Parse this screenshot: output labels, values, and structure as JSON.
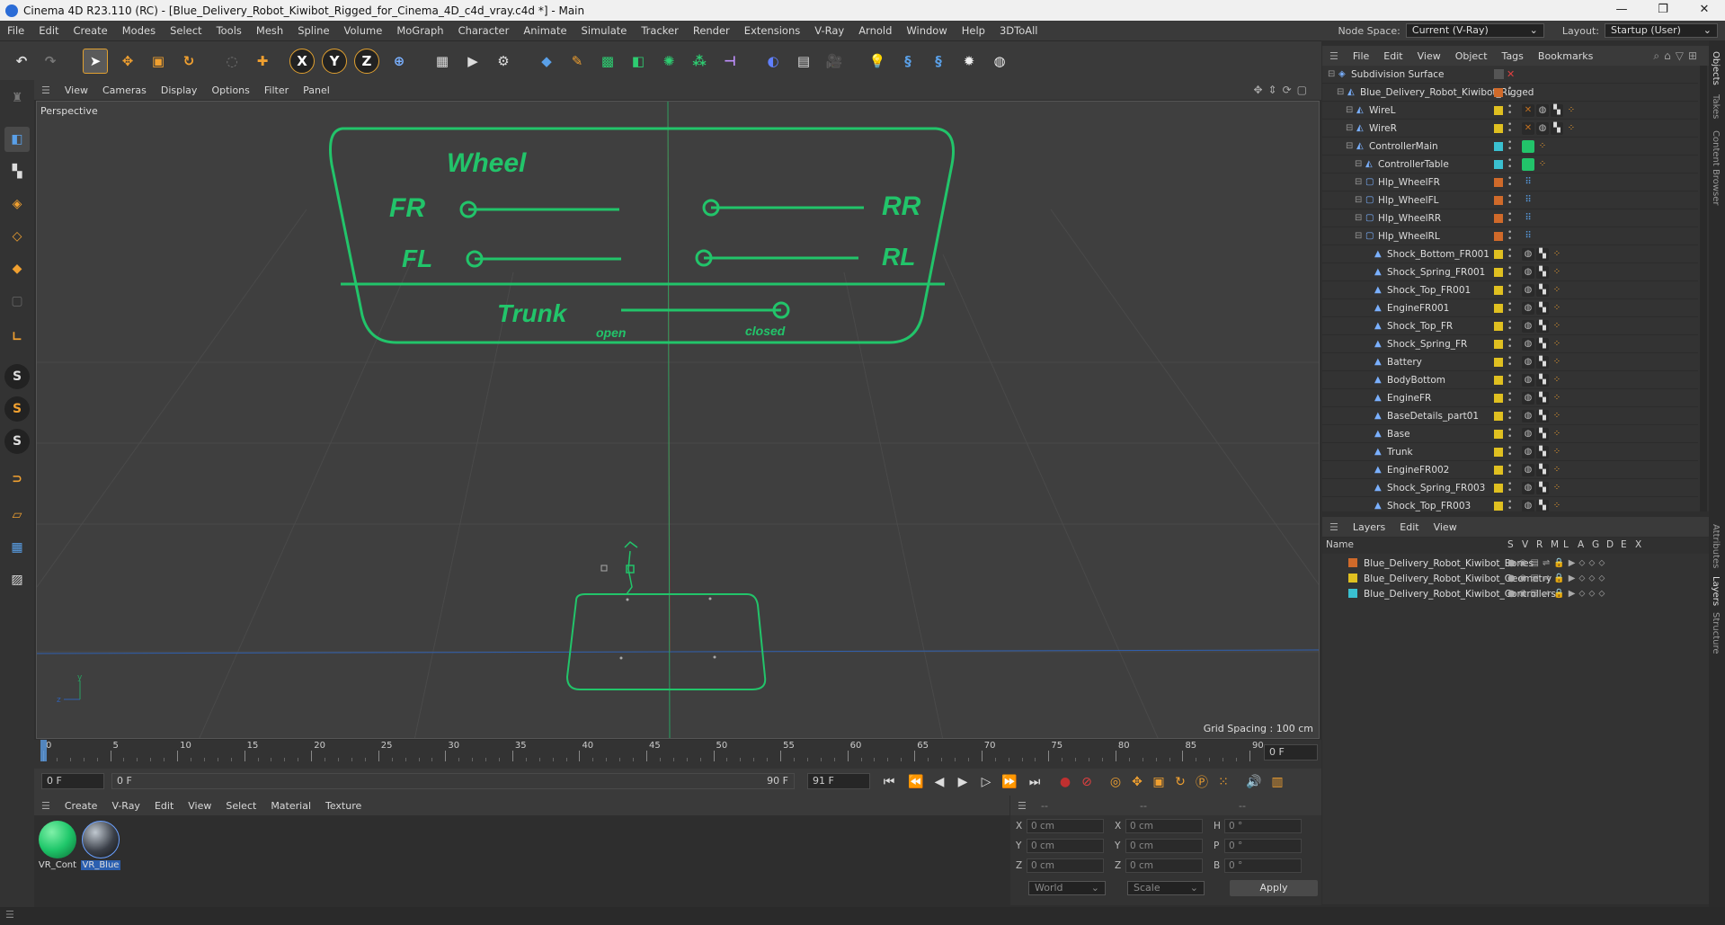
{
  "window": {
    "title": "Cinema 4D R23.110 (RC) - [Blue_Delivery_Robot_Kiwibot_Rigged_for_Cinema_4D_c4d_vray.c4d *] - Main",
    "controls": [
      "—",
      "❐",
      "✕"
    ]
  },
  "menubar": {
    "items": [
      "File",
      "Edit",
      "Create",
      "Modes",
      "Select",
      "Tools",
      "Mesh",
      "Spline",
      "Volume",
      "MoGraph",
      "Character",
      "Animate",
      "Simulate",
      "Tracker",
      "Render",
      "Extensions",
      "V-Ray",
      "Arnold",
      "Window",
      "Help",
      "3DToAll"
    ],
    "node_space_label": "Node Space:",
    "node_space_value": "Current (V-Ray)",
    "layout_label": "Layout:",
    "layout_value": "Startup (User)"
  },
  "viewport": {
    "menu": [
      "View",
      "Cameras",
      "Display",
      "Options",
      "Filter",
      "Panel"
    ],
    "camera_label": "Perspective",
    "grid_spacing": "Grid Spacing : 100 cm",
    "controller": {
      "title": "Wheel",
      "fr": "FR",
      "rr": "RR",
      "fl": "FL",
      "rl": "RL",
      "trunk": "Trunk",
      "open": "open",
      "closed": "closed"
    },
    "colors": {
      "controller": "#22c46a",
      "axis_red": "#b03030",
      "axis_blue": "#3060b0"
    }
  },
  "timeline": {
    "ticks": [
      "0",
      "5",
      "10",
      "15",
      "20",
      "25",
      "30",
      "35",
      "40",
      "45",
      "50",
      "55",
      "60",
      "65",
      "70",
      "75",
      "80",
      "85",
      "90"
    ],
    "current_frame_display": "0 F",
    "start_field": "0 F",
    "range_start": "0 F",
    "range_end": "90 F",
    "end_field": "91 F"
  },
  "materials": {
    "menu": [
      "Create",
      "V-Ray",
      "Edit",
      "View",
      "Select",
      "Material",
      "Texture"
    ],
    "items": [
      {
        "name": "VR_Cont",
        "color": "#1fc76a"
      },
      {
        "name": "VR_Blue",
        "color": "#3a3f48"
      }
    ]
  },
  "coordinates": {
    "header": [
      "--",
      "--",
      "--"
    ],
    "rows": [
      {
        "a": "X",
        "av": "0 cm",
        "b": "X",
        "bv": "0 cm",
        "c": "H",
        "cv": "0 °"
      },
      {
        "a": "Y",
        "av": "0 cm",
        "b": "Y",
        "bv": "0 cm",
        "c": "P",
        "cv": "0 °"
      },
      {
        "a": "Z",
        "av": "0 cm",
        "b": "Z",
        "bv": "0 cm",
        "c": "B",
        "cv": "0 °"
      }
    ],
    "world": "World",
    "scale": "Scale",
    "apply": "Apply"
  },
  "object_manager": {
    "menu": [
      "File",
      "Edit",
      "View",
      "Object",
      "Tags",
      "Bookmarks"
    ],
    "objects": [
      {
        "name": "Subdivision Surface",
        "indent": 0,
        "chip": "",
        "tags": []
      },
      {
        "name": "Blue_Delivery_Robot_Kiwibot_Rigged",
        "indent": 1,
        "chip": "#d06a2a",
        "tags": []
      },
      {
        "name": "WireL",
        "indent": 2,
        "chip": "#e0c020",
        "tags": [
          "x",
          "s",
          "c",
          "d"
        ]
      },
      {
        "name": "WireR",
        "indent": 2,
        "chip": "#e0c020",
        "tags": [
          "x",
          "s",
          "c",
          "d"
        ]
      },
      {
        "name": "ControllerMain",
        "indent": 2,
        "chip": "#3ac0d0",
        "tags": [
          "g",
          "d"
        ]
      },
      {
        "name": "ControllerTable",
        "indent": 3,
        "chip": "#3ac0d0",
        "tags": [
          "g",
          "d"
        ]
      },
      {
        "name": "Hlp_WheelFR",
        "indent": 3,
        "chip": "#d06a2a",
        "tags": [
          "p"
        ]
      },
      {
        "name": "Hlp_WheelFL",
        "indent": 3,
        "chip": "#d06a2a",
        "tags": [
          "p"
        ]
      },
      {
        "name": "Hlp_WheelRR",
        "indent": 3,
        "chip": "#d06a2a",
        "tags": [
          "p"
        ]
      },
      {
        "name": "Hlp_WheelRL",
        "indent": 3,
        "chip": "#d06a2a",
        "tags": [
          "p"
        ]
      },
      {
        "name": "Shock_Bottom_FR001",
        "indent": 4,
        "chip": "#e0c020",
        "tags": [
          "s",
          "c",
          "d"
        ]
      },
      {
        "name": "Shock_Spring_FR001",
        "indent": 4,
        "chip": "#e0c020",
        "tags": [
          "s",
          "c",
          "d"
        ]
      },
      {
        "name": "Shock_Top_FR001",
        "indent": 4,
        "chip": "#e0c020",
        "tags": [
          "s",
          "c",
          "d"
        ]
      },
      {
        "name": "EngineFR001",
        "indent": 4,
        "chip": "#e0c020",
        "tags": [
          "s",
          "c",
          "d"
        ]
      },
      {
        "name": "Shock_Top_FR",
        "indent": 4,
        "chip": "#e0c020",
        "tags": [
          "s",
          "c",
          "d"
        ]
      },
      {
        "name": "Shock_Spring_FR",
        "indent": 4,
        "chip": "#e0c020",
        "tags": [
          "s",
          "c",
          "d"
        ]
      },
      {
        "name": "Battery",
        "indent": 4,
        "chip": "#e0c020",
        "tags": [
          "s",
          "c",
          "d"
        ]
      },
      {
        "name": "BodyBottom",
        "indent": 4,
        "chip": "#e0c020",
        "tags": [
          "s",
          "c",
          "d"
        ]
      },
      {
        "name": "EngineFR",
        "indent": 4,
        "chip": "#e0c020",
        "tags": [
          "s",
          "c",
          "d"
        ]
      },
      {
        "name": "BaseDetails_part01",
        "indent": 4,
        "chip": "#e0c020",
        "tags": [
          "s",
          "c",
          "d"
        ]
      },
      {
        "name": "Base",
        "indent": 4,
        "chip": "#e0c020",
        "tags": [
          "s",
          "c",
          "d"
        ]
      },
      {
        "name": "Trunk",
        "indent": 4,
        "chip": "#e0c020",
        "tags": [
          "s",
          "c",
          "d"
        ]
      },
      {
        "name": "EngineFR002",
        "indent": 4,
        "chip": "#e0c020",
        "tags": [
          "s",
          "c",
          "d"
        ]
      },
      {
        "name": "Shock_Spring_FR003",
        "indent": 4,
        "chip": "#e0c020",
        "tags": [
          "s",
          "c",
          "d"
        ]
      },
      {
        "name": "Shock_Top_FR003",
        "indent": 4,
        "chip": "#e0c020",
        "tags": [
          "s",
          "c",
          "d"
        ]
      }
    ]
  },
  "layers": {
    "menu": [
      "Layers",
      "Edit",
      "View"
    ],
    "columns": [
      "Name",
      "S",
      "V",
      "R",
      "M",
      "L",
      "A",
      "G",
      "D",
      "E",
      "X"
    ],
    "items": [
      {
        "name": "Blue_Delivery_Robot_Kiwibot_Bones",
        "color": "#d06a2a"
      },
      {
        "name": "Blue_Delivery_Robot_Kiwibot_Geometry",
        "color": "#e0c020"
      },
      {
        "name": "Blue_Delivery_Robot_Kiwibot_Controllers",
        "color": "#3ac0d0"
      }
    ]
  },
  "side_tabs": [
    "Objects",
    "Takes",
    "Content Browser",
    "Attributes",
    "Layers",
    "Structure"
  ]
}
